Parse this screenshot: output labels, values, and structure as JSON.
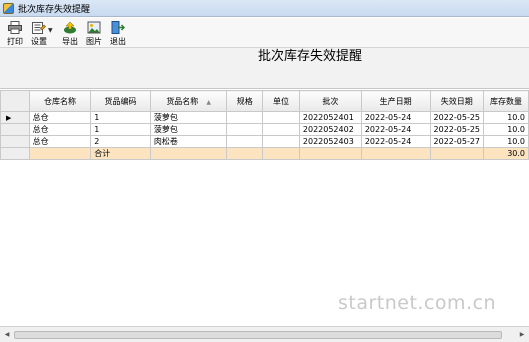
{
  "window": {
    "title": "批次库存失效提醒"
  },
  "toolbar": {
    "print": {
      "label": "打印",
      "icon": "printer-icon"
    },
    "settings": {
      "label": "设置",
      "icon": "settings-icon"
    },
    "export": {
      "label": "导出",
      "icon": "export-icon"
    },
    "image": {
      "label": "图片",
      "icon": "image-icon"
    },
    "exit": {
      "label": "退出",
      "icon": "exit-icon"
    }
  },
  "report": {
    "title": "批次库存失效提醒"
  },
  "table": {
    "columns": [
      "仓库名称",
      "货品编码",
      "货品名称",
      "规格",
      "单位",
      "批次",
      "生产日期",
      "失效日期",
      "库存数量"
    ],
    "rows": [
      [
        "总仓",
        "1",
        "菠萝包",
        "",
        "",
        "2022052401",
        "2022-05-24",
        "2022-05-25",
        "10.0"
      ],
      [
        "总仓",
        "1",
        "菠萝包",
        "",
        "",
        "2022052402",
        "2022-05-24",
        "2022-05-25",
        "10.0"
      ],
      [
        "总仓",
        "2",
        "肉松卷",
        "",
        "",
        "2022052403",
        "2022-05-24",
        "2022-05-27",
        "10.0"
      ]
    ],
    "total": {
      "label": "合计",
      "quantity": "30.0"
    }
  },
  "watermark": "startnet.com.cn",
  "colors": {
    "total_row": "#fce4c0",
    "titlebar": "#dbe7f5"
  }
}
